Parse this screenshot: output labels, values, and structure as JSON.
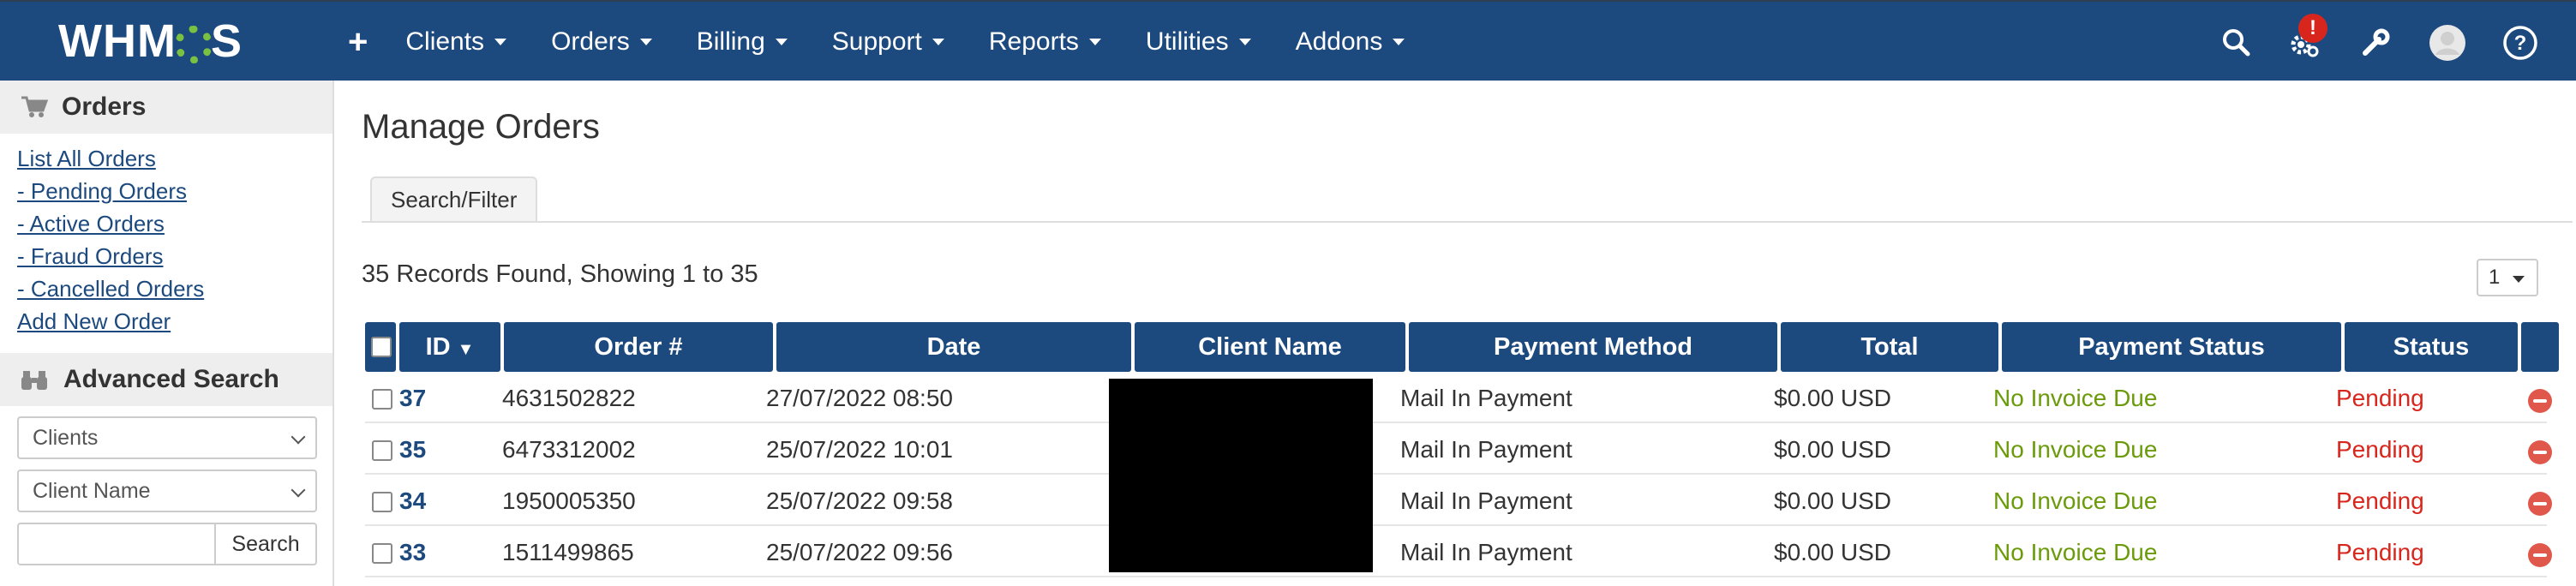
{
  "app": {
    "logo_text_left": "WHM",
    "logo_text_right": "S"
  },
  "topnav": {
    "items": [
      {
        "label": "Clients"
      },
      {
        "label": "Orders"
      },
      {
        "label": "Billing"
      },
      {
        "label": "Support"
      },
      {
        "label": "Reports"
      },
      {
        "label": "Utilities"
      },
      {
        "label": "Addons"
      }
    ],
    "plus_label": "+",
    "notification_badge": "!",
    "icons": [
      "search-icon",
      "gear-icon",
      "wrench-icon",
      "avatar",
      "help-icon"
    ]
  },
  "sidebar": {
    "orders_title": "Orders",
    "links": [
      {
        "label": "List All Orders"
      },
      {
        "label": "- Pending Orders"
      },
      {
        "label": "- Active Orders"
      },
      {
        "label": "- Fraud Orders"
      },
      {
        "label": "- Cancelled Orders"
      },
      {
        "label": "Add New Order"
      }
    ],
    "advanced_title": "Advanced Search",
    "select_type": "Clients",
    "select_field": "Client Name",
    "search_value": "",
    "search_button": "Search"
  },
  "main": {
    "title": "Manage Orders",
    "filter_tab": "Search/Filter",
    "records_text": "35 Records Found, Showing 1 to 35",
    "page_select": "1"
  },
  "table": {
    "headers": {
      "id": "ID",
      "id_sort": "▼",
      "order_num": "Order #",
      "date": "Date",
      "client": "Client Name",
      "method": "Payment Method",
      "total": "Total",
      "pay_status": "Payment Status",
      "status": "Status"
    },
    "rows": [
      {
        "id": "37",
        "order_num": "4631502822",
        "date": "27/07/2022 08:50",
        "method": "Mail In Payment",
        "total": "$0.00 USD",
        "pay_status": "No Invoice Due",
        "status": "Pending"
      },
      {
        "id": "35",
        "order_num": "6473312002",
        "date": "25/07/2022 10:01",
        "method": "Mail In Payment",
        "total": "$0.00 USD",
        "pay_status": "No Invoice Due",
        "status": "Pending"
      },
      {
        "id": "34",
        "order_num": "1950005350",
        "date": "25/07/2022 09:58",
        "method": "Mail In Payment",
        "total": "$0.00 USD",
        "pay_status": "No Invoice Due",
        "status": "Pending"
      },
      {
        "id": "33",
        "order_num": "1511499865",
        "date": "25/07/2022 09:56",
        "method": "Mail In Payment",
        "total": "$0.00 USD",
        "pay_status": "No Invoice Due",
        "status": "Pending"
      }
    ]
  },
  "colors": {
    "nav_bg": "#1d4a7e",
    "paid_green": "#6b9a0a",
    "pending_red": "#d9261c"
  }
}
